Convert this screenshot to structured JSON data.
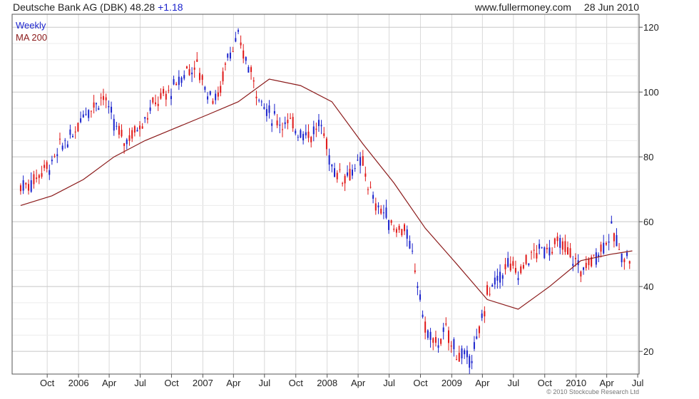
{
  "header": {
    "title": "Deutsche Bank AG (DBK) 48.28",
    "change": "+1.18",
    "site": "www.fullermoney.com",
    "date": "28 Jun 2010"
  },
  "legend": {
    "weekly": "Weekly",
    "ma": "MA 200"
  },
  "footer": {
    "copyright": "© 2010 Stockcube Research Ltd"
  },
  "colors": {
    "up": "#1a22cc",
    "down": "#e01818",
    "ma": "#8b1a1a",
    "grid": "#d9d9d9"
  },
  "chart_data": {
    "type": "candlestick",
    "frequency": "weekly",
    "ylim": [
      13,
      124
    ],
    "yticks": [
      20,
      40,
      60,
      80,
      100,
      120
    ],
    "x_labels": [
      "Oct",
      "2006",
      "Apr",
      "Jul",
      "Oct",
      "2007",
      "Apr",
      "Jul",
      "Oct",
      "2008",
      "Apr",
      "Jul",
      "Oct",
      "2009",
      "Apr",
      "Jul",
      "Oct",
      "2010",
      "Apr",
      "Jul"
    ],
    "series": [
      {
        "name": "Weekly",
        "kind": "price",
        "x": [
          "2005-07",
          "2005-08",
          "2005-09",
          "2005-10",
          "2005-11",
          "2005-12",
          "2006-01",
          "2006-02",
          "2006-03",
          "2006-04",
          "2006-05",
          "2006-06",
          "2006-07",
          "2006-08",
          "2006-09",
          "2006-10",
          "2006-11",
          "2006-12",
          "2007-01",
          "2007-02",
          "2007-03",
          "2007-04",
          "2007-05",
          "2007-06",
          "2007-07",
          "2007-08",
          "2007-09",
          "2007-10",
          "2007-11",
          "2007-12",
          "2008-01",
          "2008-02",
          "2008-03",
          "2008-04",
          "2008-05",
          "2008-06",
          "2008-07",
          "2008-08",
          "2008-09",
          "2008-10",
          "2008-11",
          "2008-12",
          "2009-01",
          "2009-02",
          "2009-03",
          "2009-04",
          "2009-05",
          "2009-06",
          "2009-07",
          "2009-08",
          "2009-09",
          "2009-10",
          "2009-11",
          "2009-12",
          "2010-01",
          "2010-02",
          "2010-03",
          "2010-04",
          "2010-05",
          "2010-06"
        ],
        "values": [
          71,
          72,
          76,
          78,
          84,
          86,
          94,
          96,
          99,
          90,
          85,
          88,
          92,
          97,
          99,
          102,
          107,
          108,
          100,
          98,
          112,
          116,
          108,
          99,
          93,
          91,
          90,
          88,
          87,
          90,
          77,
          74,
          76,
          78,
          66,
          63,
          58,
          58,
          46,
          27,
          22,
          26,
          20,
          17,
          22,
          38,
          42,
          47,
          44,
          49,
          51,
          52,
          53,
          50,
          45,
          48,
          52,
          57,
          50,
          48
        ]
      },
      {
        "name": "MA 200",
        "kind": "moving-average",
        "x": [
          "2005-07",
          "2005-10",
          "2006-01",
          "2006-04",
          "2006-07",
          "2006-10",
          "2007-01",
          "2007-04",
          "2007-07",
          "2007-10",
          "2008-01",
          "2008-04",
          "2008-07",
          "2008-10",
          "2009-01",
          "2009-04",
          "2009-07",
          "2009-10",
          "2010-01",
          "2010-04",
          "2010-06"
        ],
        "values": [
          65,
          68,
          73,
          80,
          85,
          89,
          93,
          97,
          104,
          102,
          97,
          84,
          72,
          58,
          47,
          36,
          33,
          40,
          48,
          50,
          51
        ]
      }
    ]
  }
}
